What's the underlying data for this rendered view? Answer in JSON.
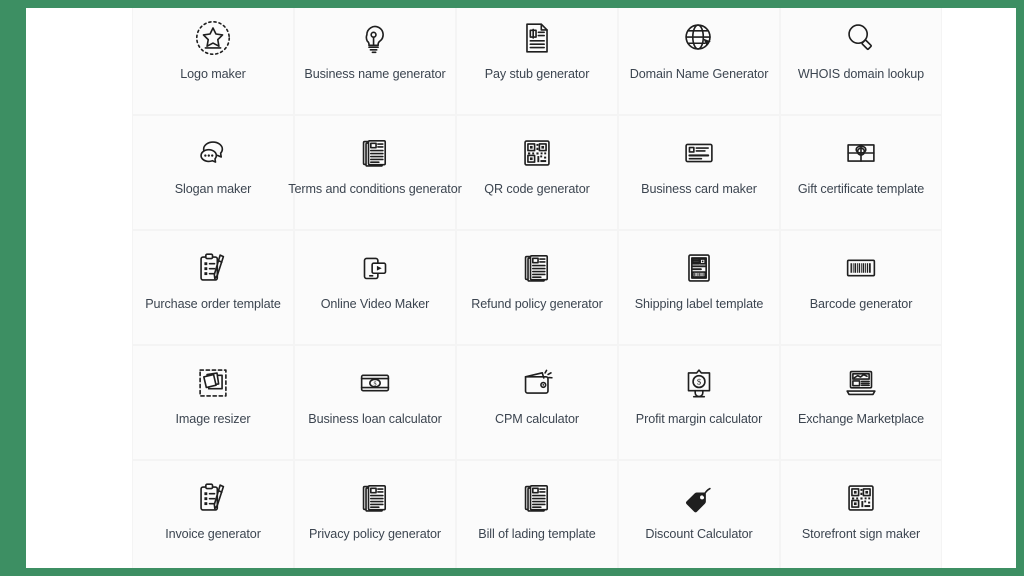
{
  "frame": {
    "border_color": "#3d8f63",
    "canvas_color": "#ffffff",
    "tile_color": "#fbfbfb",
    "label_color": "#3c4550",
    "icon_color": "#1f1f1f"
  },
  "grid": {
    "columns": 5,
    "rows": 5,
    "items": [
      {
        "label": "Logo maker",
        "icon": "star-badge-icon"
      },
      {
        "label": "Business name generator",
        "icon": "lightbulb-icon"
      },
      {
        "label": "Pay stub generator",
        "icon": "pay-stub-document-icon"
      },
      {
        "label": "Domain Name Generator",
        "icon": "globe-cursor-icon"
      },
      {
        "label": "WHOIS domain lookup",
        "icon": "magnifier-icon"
      },
      {
        "label": "Slogan maker",
        "icon": "speech-bubbles-icon"
      },
      {
        "label": "Terms and conditions generator",
        "icon": "document-stack-icon"
      },
      {
        "label": "QR code generator",
        "icon": "qr-code-icon"
      },
      {
        "label": "Business card maker",
        "icon": "business-card-icon"
      },
      {
        "label": "Gift certificate template",
        "icon": "gift-certificate-icon"
      },
      {
        "label": "Purchase order template",
        "icon": "clipboard-pen-icon"
      },
      {
        "label": "Online Video Maker",
        "icon": "phone-play-icon"
      },
      {
        "label": "Refund policy generator",
        "icon": "document-stack-icon"
      },
      {
        "label": "Shipping label template",
        "icon": "shipping-label-icon"
      },
      {
        "label": "Barcode generator",
        "icon": "barcode-icon"
      },
      {
        "label": "Image resizer",
        "icon": "image-resize-icon"
      },
      {
        "label": "Business loan calculator",
        "icon": "banknote-icon"
      },
      {
        "label": "CPM calculator",
        "icon": "wallet-icon"
      },
      {
        "label": "Profit margin calculator",
        "icon": "dollar-sign-board-icon"
      },
      {
        "label": "Exchange Marketplace",
        "icon": "laptop-chart-icon"
      },
      {
        "label": "Invoice generator",
        "icon": "clipboard-pen-icon"
      },
      {
        "label": "Privacy policy generator",
        "icon": "document-stack-icon"
      },
      {
        "label": "Bill of lading template",
        "icon": "document-stack-icon"
      },
      {
        "label": "Discount Calculator",
        "icon": "price-tag-icon"
      },
      {
        "label": "Storefront sign maker",
        "icon": "qr-code-icon"
      }
    ]
  }
}
